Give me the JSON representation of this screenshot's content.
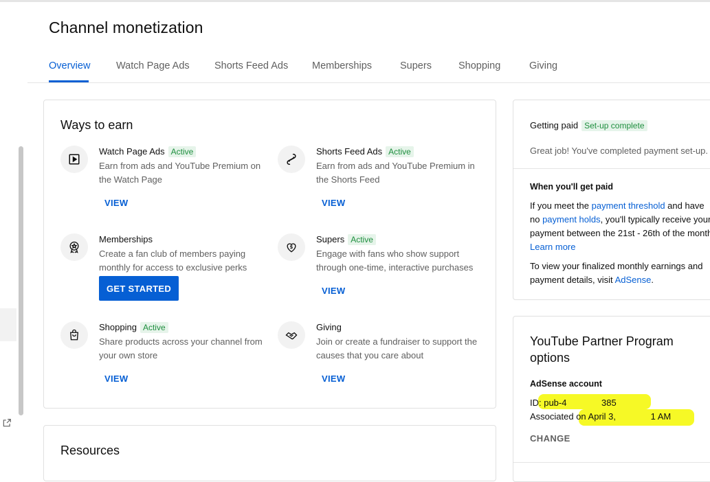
{
  "page": {
    "title": "Channel monetization"
  },
  "tabs": [
    {
      "label": "Overview",
      "active": true
    },
    {
      "label": "Watch Page Ads"
    },
    {
      "label": "Shorts Feed Ads"
    },
    {
      "label": "Memberships"
    },
    {
      "label": "Supers"
    },
    {
      "label": "Shopping"
    },
    {
      "label": "Giving"
    }
  ],
  "ways_to_earn": {
    "title": "Ways to earn",
    "items": [
      {
        "name": "Watch Page Ads",
        "badge": "Active",
        "desc": "Earn from ads and YouTube Premium on the Watch Page",
        "action": "VIEW",
        "icon": "play-icon"
      },
      {
        "name": "Shorts Feed Ads",
        "badge": "Active",
        "desc": "Earn from ads and YouTube Premium in the Shorts Feed",
        "action": "VIEW",
        "icon": "shorts-icon"
      },
      {
        "name": "Memberships",
        "badge": "",
        "desc": "Create a fan club of members paying monthly for access to exclusive perks",
        "action": "GET STARTED",
        "icon": "badge-star-icon"
      },
      {
        "name": "Supers",
        "badge": "Active",
        "desc": "Engage with fans who show support through one-time, interactive purchases",
        "action": "VIEW",
        "icon": "heart-dollar-icon"
      },
      {
        "name": "Shopping",
        "badge": "Active",
        "desc": "Share products across your channel from your own store",
        "action": "VIEW",
        "icon": "shopping-bag-icon"
      },
      {
        "name": "Giving",
        "badge": "",
        "desc": "Join or create a fundraiser to support the causes that you care about",
        "action": "VIEW",
        "icon": "handshake-heart-icon"
      }
    ]
  },
  "resources": {
    "title": "Resources"
  },
  "getting_paid": {
    "title": "Getting paid",
    "badge": "Set-up complete",
    "message": "Great job! You've completed payment set-up.",
    "when_title": "When you'll get paid",
    "when_text_1": "If you meet the ",
    "payment_threshold_link": "payment threshold",
    "when_text_2": " and have no ",
    "payment_holds_link": "payment holds",
    "when_text_3": ", you'll typically receive your payment between the 21st - 26th of the month. ",
    "learn_more_link": "Learn more",
    "finalized_text": "To view your finalized monthly earnings and payment details, visit ",
    "adsense_link": "AdSense",
    "finalized_end": "."
  },
  "ypp": {
    "title": "YouTube Partner Program options",
    "adsense_label": "AdSense account",
    "id_text": "ID: pub-4              385",
    "associated_text": "Associated on April 3,              1 AM",
    "change_label": "CHANGE"
  },
  "colors": {
    "accent": "#065fd4",
    "active_badge_text": "#1e8e3e",
    "active_badge_bg": "#e6f4ea",
    "highlight": "#f6f91a"
  }
}
